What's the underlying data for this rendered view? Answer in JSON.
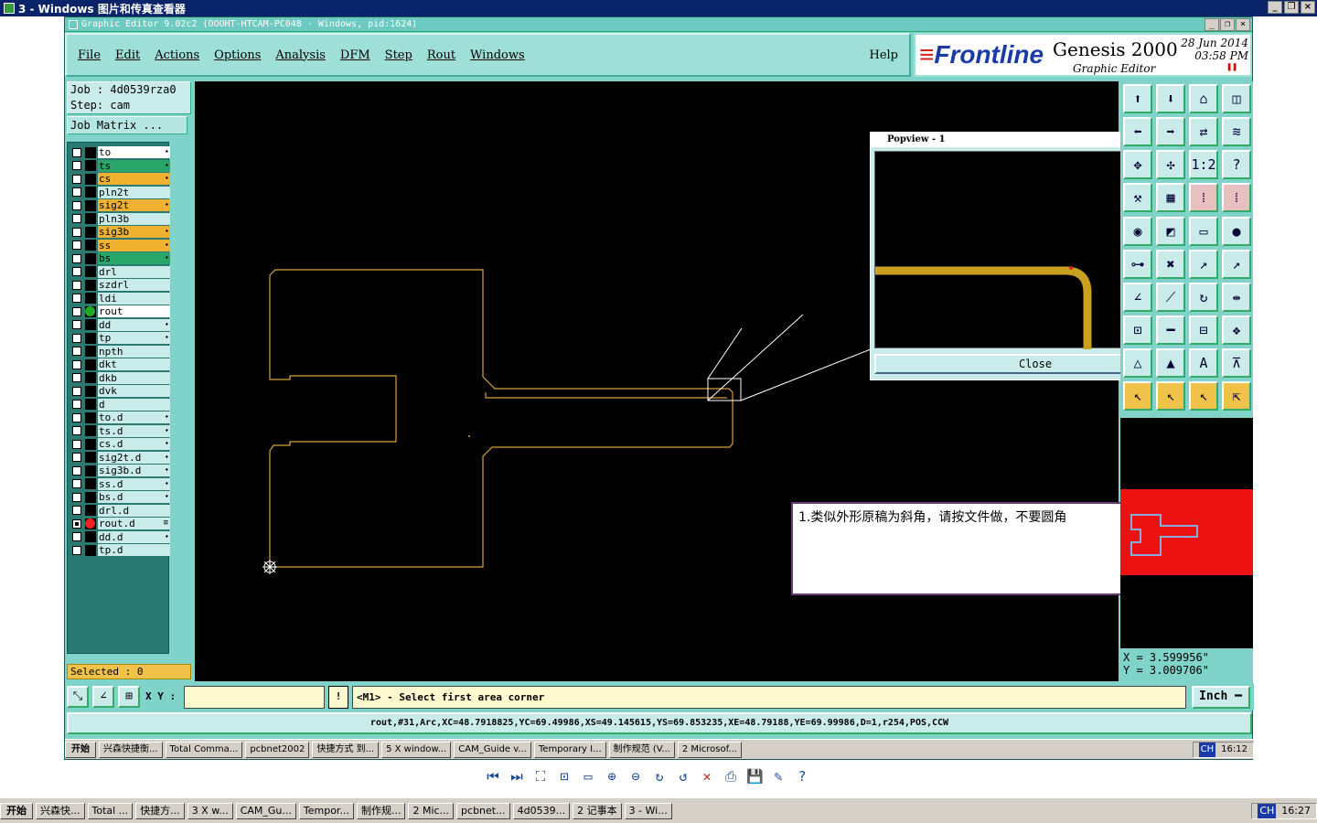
{
  "viewer": {
    "title": "3 - Windows 图片和传真查看器"
  },
  "editor": {
    "title": "Graphic Editor 9.02c2 (OOOHT-HTCAM-PC048 - Windows, pid:1624)",
    "menu": [
      "File",
      "Edit",
      "Actions",
      "Options",
      "Analysis",
      "DFM",
      "Step",
      "Rout",
      "Windows"
    ],
    "help": "Help",
    "brand": {
      "logo": "Frontline",
      "product": "Genesis 2000",
      "subtitle": "Graphic Editor",
      "date": "28 Jun 2014",
      "time": "03:58 PM"
    },
    "job": "Job : 4d0539rza0",
    "step": "Step: cam",
    "job_matrix": "Job Matrix ...",
    "layers": [
      {
        "name": "to",
        "color": "#ffffff",
        "flag": "⬩",
        "active": false,
        "fill": "#ffffff"
      },
      {
        "name": "ts",
        "color": "#2aa66a",
        "flag": "⬩",
        "active": false,
        "fill": "#2aa66a"
      },
      {
        "name": "cs",
        "color": "#f0b030",
        "flag": "⬩",
        "active": false,
        "fill": "#f0b030"
      },
      {
        "name": "pln2t",
        "color": "#c9ecea",
        "flag": "",
        "active": false,
        "fill": "#c9ecea"
      },
      {
        "name": "sig2t",
        "color": "#f0b030",
        "flag": "⬩",
        "active": false,
        "fill": "#f0b030"
      },
      {
        "name": "pln3b",
        "color": "#c9ecea",
        "flag": "",
        "active": false,
        "fill": "#c9ecea"
      },
      {
        "name": "sig3b",
        "color": "#f0b030",
        "flag": "⬩",
        "active": false,
        "fill": "#f0b030"
      },
      {
        "name": "ss",
        "color": "#f0b030",
        "flag": "⬩",
        "active": false,
        "fill": "#f0b030"
      },
      {
        "name": "bs",
        "color": "#2aa66a",
        "flag": "⬩",
        "active": false,
        "fill": "#2aa66a"
      },
      {
        "name": "drl",
        "color": "#c9ecea",
        "flag": "",
        "active": false,
        "fill": "#c9ecea"
      },
      {
        "name": "szdrl",
        "color": "#c9ecea",
        "flag": "",
        "active": false,
        "fill": "#c9ecea"
      },
      {
        "name": "ldi",
        "color": "#c9ecea",
        "flag": "",
        "active": false,
        "fill": "#c9ecea"
      },
      {
        "name": "rout",
        "color": "#ffffff",
        "flag": "",
        "active": true,
        "fill": "#ffffff"
      },
      {
        "name": "dd",
        "color": "#c9ecea",
        "flag": "⬩",
        "active": false,
        "fill": "#c9ecea"
      },
      {
        "name": "tp",
        "color": "#c9ecea",
        "flag": "⬩",
        "active": false,
        "fill": "#c9ecea"
      },
      {
        "name": "npth",
        "color": "#c9ecea",
        "flag": "",
        "active": false,
        "fill": "#c9ecea"
      },
      {
        "name": "dkt",
        "color": "#c9ecea",
        "flag": "",
        "active": false,
        "fill": "#c9ecea"
      },
      {
        "name": "dkb",
        "color": "#c9ecea",
        "flag": "",
        "active": false,
        "fill": "#c9ecea"
      },
      {
        "name": "dvk",
        "color": "#c9ecea",
        "flag": "",
        "active": false,
        "fill": "#c9ecea"
      },
      {
        "name": "d",
        "color": "#c9ecea",
        "flag": "",
        "active": false,
        "fill": "#c9ecea"
      },
      {
        "name": "to.d",
        "color": "#c9ecea",
        "flag": "⬩",
        "active": false,
        "fill": "#c9ecea"
      },
      {
        "name": "ts.d",
        "color": "#c9ecea",
        "flag": "⬩",
        "active": false,
        "fill": "#c9ecea"
      },
      {
        "name": "cs.d",
        "color": "#c9ecea",
        "flag": "⬩",
        "active": false,
        "fill": "#c9ecea"
      },
      {
        "name": "sig2t.d",
        "color": "#c9ecea",
        "flag": "⬩",
        "active": false,
        "fill": "#c9ecea"
      },
      {
        "name": "sig3b.d",
        "color": "#c9ecea",
        "flag": "⬩",
        "active": false,
        "fill": "#c9ecea"
      },
      {
        "name": "ss.d",
        "color": "#c9ecea",
        "flag": "⬩",
        "active": false,
        "fill": "#c9ecea"
      },
      {
        "name": "bs.d",
        "color": "#c9ecea",
        "flag": "⬩",
        "active": false,
        "fill": "#c9ecea"
      },
      {
        "name": "drl.d",
        "color": "#c9ecea",
        "flag": "",
        "active": false,
        "fill": "#c9ecea"
      },
      {
        "name": "rout.d",
        "color": "#c9ecea",
        "flag": "≡",
        "active": false,
        "fill": "#c9ecea",
        "red": true
      },
      {
        "name": "dd.d",
        "color": "#c9ecea",
        "flag": "⬩",
        "active": false,
        "fill": "#c9ecea"
      },
      {
        "name": "tp.d",
        "color": "#c9ecea",
        "flag": "",
        "active": false,
        "fill": "#c9ecea"
      }
    ],
    "selected": "Selected : 0",
    "popview": {
      "title": "Popview - 1",
      "close": "Close"
    },
    "note": "1.类似外形原稿为斜角，请按文件做，不要圆角",
    "coords": {
      "x": "X = 3.599956\"",
      "y": "Y = 3.009706\""
    },
    "xy_label": "X Y :",
    "xy_value": "",
    "prompt": "<M1> - Select first area corner",
    "units": "Inch ━",
    "status": "rout,#31,Arc,XC=48.7918825,YC=69.49986,XS=49.145615,YS=69.853235,XE=48.79188,YE=69.99986,D=1,r254,POS,CCW"
  },
  "inner_taskbar": {
    "start": "开始",
    "items": [
      "兴森快捷衡...",
      "Total Comma...",
      "pcbnet2002",
      "快捷方式 到...",
      "5 X window...",
      "CAM_Guide v...",
      "Temporary I...",
      "制作规范 (V...",
      "2 Microsof..."
    ],
    "ime": "CH",
    "clock": "16:12"
  },
  "outer_taskbar": {
    "start": "开始",
    "items": [
      "兴森快...",
      "Total ...",
      "快捷方...",
      "3 X w...",
      "CAM_Gu...",
      "Tempor...",
      "制作规...",
      "2 Mic...",
      "pcbnet...",
      "4d0539...",
      "2 记事本",
      "3 - Wi..."
    ],
    "ime": "CH",
    "clock": "16:27"
  }
}
